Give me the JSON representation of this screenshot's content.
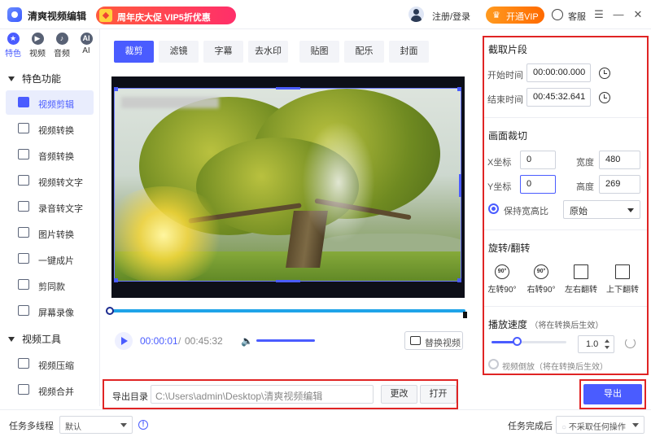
{
  "app": {
    "title": "清爽视频编辑",
    "promo": "周年庆大促 VIP5折优惠",
    "login": "注册/登录",
    "vip_button": "开通VIP",
    "customer_service": "客服",
    "menu_glyph": "☰",
    "minimize_glyph": "—",
    "close_glyph": "✕"
  },
  "topnav": [
    {
      "label": "特色",
      "glyph": "★",
      "active": true
    },
    {
      "label": "视频",
      "glyph": "▶",
      "active": false
    },
    {
      "label": "音频",
      "glyph": "♪",
      "active": false
    },
    {
      "label": "AI",
      "glyph": "AI",
      "active": false
    }
  ],
  "sidebar": {
    "group1": "特色功能",
    "items1": [
      "视频剪辑",
      "视频转换",
      "音频转换",
      "视频转文字",
      "录音转文字",
      "图片转换",
      "一键成片",
      "剪同款",
      "屏幕录像"
    ],
    "group2": "视频工具",
    "items2": [
      "视频压缩",
      "视频合并"
    ]
  },
  "tabs": [
    "裁剪",
    "滤镜",
    "字幕",
    "去水印",
    "贴图",
    "配乐",
    "封面"
  ],
  "player": {
    "current_time": "00:00:01",
    "separator": "/",
    "total_time": "00:45:32",
    "replace_button": "替换视频"
  },
  "export": {
    "label": "导出目录",
    "path": "C:\\Users\\admin\\Desktop\\清爽视频编辑",
    "change_button": "更改",
    "open_button": "打开",
    "export_button": "导出"
  },
  "right_panel": {
    "clip_title": "截取片段",
    "start_label": "开始时间",
    "start_value": "00:00:00.000",
    "end_label": "结束时间",
    "end_value": "00:45:32.641",
    "crop_title": "画面裁切",
    "x_label": "X坐标",
    "x_value": "0",
    "width_label": "宽度",
    "width_value": "480",
    "y_label": "Y坐标",
    "y_value": "0",
    "height_label": "高度",
    "height_value": "269",
    "keep_ratio": "保持宽高比",
    "ratio_value": "原始",
    "rotate_title": "旋转/翻转",
    "rotate_buttons": [
      "左转90°",
      "右转90°",
      "左右翻转",
      "上下翻转"
    ],
    "rotate_icon_text": [
      "90°",
      "90°",
      "",
      ""
    ],
    "speed_title": "播放速度",
    "speed_note": "（将在转换后生效）",
    "speed_value": "1.0",
    "reverse_label": "视频倒放",
    "reverse_note": "（将在转换后生效）"
  },
  "bottom": {
    "threads_label": "任务多线程",
    "threads_value": "默认",
    "after_label": "任务完成后",
    "after_value": "不采取任何操作"
  },
  "colors": {
    "accent": "#4a5cff",
    "highlight_border": "#e02424",
    "vip": "#ff7a10",
    "promo": "#ff3a55"
  }
}
